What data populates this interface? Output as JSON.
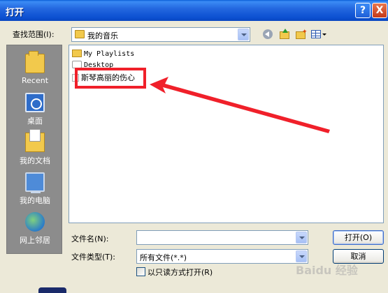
{
  "window": {
    "title": "打开",
    "help_label": "?",
    "close_label": "X"
  },
  "lookin": {
    "label": "查找范围(I):",
    "value": "我的音乐"
  },
  "toolbar": {
    "icons": [
      "back-icon",
      "up-folder-icon",
      "new-folder-icon",
      "views-menu-icon"
    ]
  },
  "places": [
    {
      "label": "Recent",
      "icon": "recent-folder-icon"
    },
    {
      "label": "桌面",
      "icon": "desktop-icon"
    },
    {
      "label": "我的文档",
      "icon": "my-documents-icon"
    },
    {
      "label": "我的电脑",
      "icon": "my-computer-icon"
    },
    {
      "label": "网上邻居",
      "icon": "network-places-icon"
    }
  ],
  "files": [
    {
      "name": "My Playlists",
      "type": "folder"
    },
    {
      "name": "Desktop",
      "type": "shortcut"
    },
    {
      "name": "斯琴高丽的伤心",
      "type": "file"
    }
  ],
  "fields": {
    "filename_label": "文件名(N):",
    "filename_value": "",
    "filetype_label": "文件类型(T):",
    "filetype_value": "所有文件(*.*)",
    "readonly_label": "以只读方式打开(R)"
  },
  "buttons": {
    "open": "打开(O)",
    "cancel": "取消"
  },
  "annotation": {
    "color": "#F0202A"
  },
  "watermark": "Baidu 经验"
}
